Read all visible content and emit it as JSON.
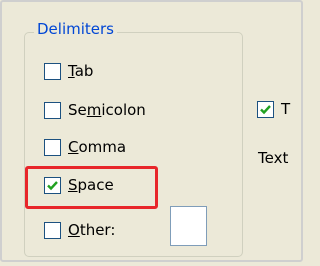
{
  "groupbox": {
    "title": "Delimiters",
    "options": [
      {
        "pre": "",
        "key": "T",
        "post": "ab",
        "checked": false
      },
      {
        "pre": "Se",
        "key": "m",
        "post": "icolon",
        "checked": false
      },
      {
        "pre": "",
        "key": "C",
        "post": "omma",
        "checked": false
      },
      {
        "pre": "",
        "key": "S",
        "post": "pace",
        "checked": true
      },
      {
        "pre": "",
        "key": "O",
        "post": "ther:",
        "checked": false
      }
    ],
    "other_value": ""
  },
  "right": {
    "checkbox_label": "T",
    "checkbox_checked": true,
    "text_label": "Text"
  },
  "colors": {
    "title": "#0046d5",
    "checkmark": "#21a121",
    "highlight": "#e8262a"
  },
  "icons": {
    "check": "checkmark-icon"
  }
}
